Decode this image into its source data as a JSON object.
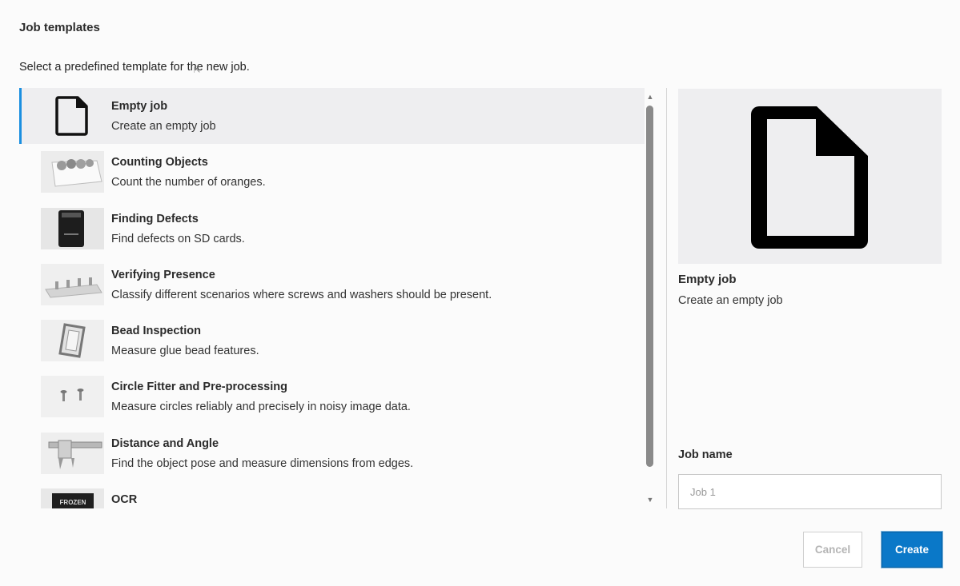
{
  "dialog": {
    "title": "Job templates",
    "subtitle": "Select a predefined template for the new job."
  },
  "templates": [
    {
      "title": "Empty job",
      "description": "Create an empty job",
      "thumb": "document-icon",
      "selected": true
    },
    {
      "title": "Counting Objects",
      "description": "Count the number of oranges.",
      "thumb": "oranges-box-photo"
    },
    {
      "title": "Finding Defects",
      "description": "Find defects on SD cards.",
      "thumb": "sd-card-photo"
    },
    {
      "title": "Verifying Presence",
      "description": "Classify different scenarios where screws and washers should be present.",
      "thumb": "screws-plate-photo"
    },
    {
      "title": "Bead Inspection",
      "description": "Measure glue bead features.",
      "thumb": "glue-bead-photo"
    },
    {
      "title": "Circle Fitter and Pre-processing",
      "description": "Measure circles reliably and precisely in noisy image data.",
      "thumb": "bolts-photo"
    },
    {
      "title": "Distance and Angle",
      "description": "Find the object pose and measure dimensions from edges.",
      "thumb": "caliper-photo"
    },
    {
      "title": "OCR",
      "description": "",
      "thumb": "frozen-label-photo",
      "thumb_text": "FROZEN"
    }
  ],
  "preview": {
    "title": "Empty job",
    "description": "Create an empty job",
    "icon": "document-icon"
  },
  "job_name": {
    "label": "Job name",
    "placeholder": "Job 1",
    "value": ""
  },
  "buttons": {
    "cancel": "Cancel",
    "create": "Create"
  },
  "colors": {
    "accent": "#0a78c8",
    "selection_bar": "#1a8fe0",
    "selected_row": "#eeeef0"
  }
}
